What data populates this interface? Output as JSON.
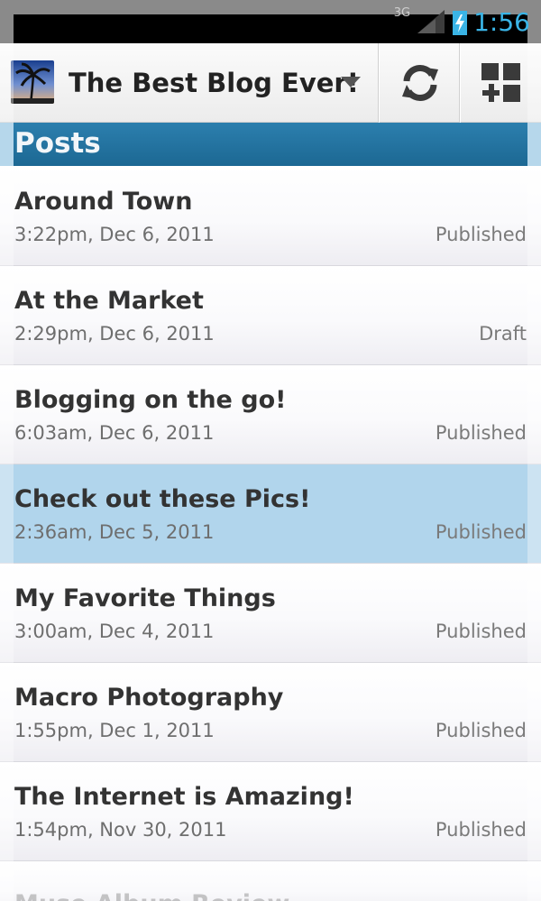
{
  "status_bar": {
    "network": "3G",
    "time": "1:56"
  },
  "action_bar": {
    "blog_title": "The Best Blog Ever!"
  },
  "section": {
    "title": "Posts"
  },
  "posts": [
    {
      "title": "Around Town",
      "date": "3:22pm, Dec 6, 2011",
      "status": "Published",
      "selected": false
    },
    {
      "title": "At the Market",
      "date": "2:29pm, Dec 6, 2011",
      "status": "Draft",
      "selected": false
    },
    {
      "title": "Blogging on the go!",
      "date": "6:03am, Dec 6, 2011",
      "status": "Published",
      "selected": false
    },
    {
      "title": "Check out these Pics!",
      "date": "2:36am, Dec 5, 2011",
      "status": "Published",
      "selected": true
    },
    {
      "title": "My Favorite Things",
      "date": "3:00am, Dec 4, 2011",
      "status": "Published",
      "selected": false
    },
    {
      "title": "Macro Photography",
      "date": "1:55pm, Dec 1, 2011",
      "status": "Published",
      "selected": false
    },
    {
      "title": "The Internet is Amazing!",
      "date": "1:54pm, Nov 30, 2011",
      "status": "Published",
      "selected": false
    },
    {
      "title": "Muse Album Review",
      "date": "",
      "status": "",
      "selected": false
    }
  ],
  "icons": {
    "blog_avatar": "palm-tree-icon",
    "dropdown": "chevron-down-icon",
    "refresh": "refresh-icon",
    "add": "add-post-icon",
    "signal": "signal-icon",
    "battery": "battery-charging-icon"
  },
  "colors": {
    "header": "#1f6d99",
    "selected_row": "#b1d5ec",
    "clock": "#3ab4e6"
  }
}
